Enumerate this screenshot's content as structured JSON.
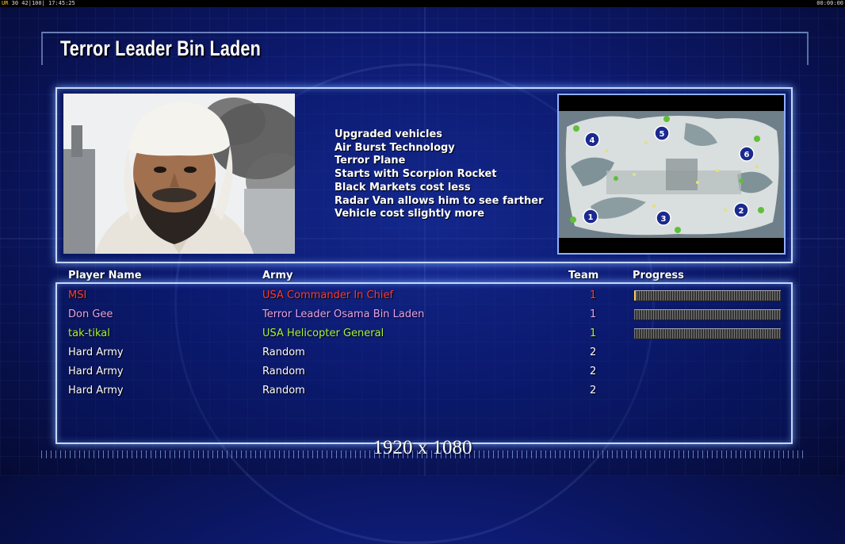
{
  "topbar": {
    "ur": "UR",
    "fps": "30 42",
    "speed": "100",
    "time": "17:45:25",
    "clock": "00:00:00"
  },
  "title": "Terror Leader Bin Laden",
  "features": [
    "Upgraded vehicles",
    "Air Burst Technology",
    "Terror Plane",
    "Starts with Scorpion Rocket",
    "Black Markets cost less",
    "Radar Van allows him to see farther",
    "Vehicle cost slightly more"
  ],
  "minimap": {
    "start_positions": [
      "1",
      "2",
      "3",
      "4",
      "5",
      "6"
    ]
  },
  "roster": {
    "headers": {
      "player": "Player Name",
      "army": "Army",
      "team": "Team",
      "progress": "Progress"
    },
    "rows": [
      {
        "player": "MSI",
        "army": "USA Commander In Chief",
        "team": "1",
        "color": "#ff3b2f",
        "progress": 0.01
      },
      {
        "player": "Don Gee",
        "army": "Terror Leader Osama Bin Laden",
        "team": "1",
        "color": "#e6a3f2",
        "progress": 0
      },
      {
        "player": "tak-tikal",
        "army": "USA Helicopter General",
        "team": "1",
        "color": "#a8f53a",
        "progress": 0
      },
      {
        "player": "Hard Army",
        "army": "Random",
        "team": "2",
        "color": "#ffffff",
        "progress": null
      },
      {
        "player": "Hard Army",
        "army": "Random",
        "team": "2",
        "color": "#ffffff",
        "progress": null
      },
      {
        "player": "Hard Army",
        "army": "Random",
        "team": "2",
        "color": "#ffffff",
        "progress": null
      }
    ]
  },
  "resolution": "1920 x 1080",
  "colors": {
    "background": "#0d1a70",
    "panel_border": "#d2e1ff",
    "progress_fill": "#ffd84a"
  }
}
